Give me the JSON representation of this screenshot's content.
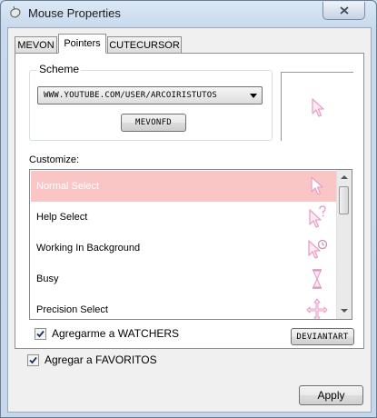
{
  "window": {
    "title": "Mouse Properties"
  },
  "tabs": [
    {
      "label": "MEVON"
    },
    {
      "label": "Pointers"
    },
    {
      "label": "CUTECURSOR"
    }
  ],
  "scheme": {
    "label": "Scheme",
    "selected": "WWW.YOUTUBE.COM/USER/ARCOIRISTUTOS",
    "button_label": "MEVONFD"
  },
  "customize": {
    "label": "Customize:",
    "rows": [
      {
        "label": "Normal Select",
        "icon": "arrow-cursor-icon",
        "selected": true
      },
      {
        "label": "Help Select",
        "icon": "help-cursor-icon",
        "selected": false
      },
      {
        "label": "Working In Background",
        "icon": "busy-background-cursor-icon",
        "selected": false
      },
      {
        "label": "Busy",
        "icon": "hourglass-cursor-icon",
        "selected": false
      },
      {
        "label": "Precision Select",
        "icon": "precision-cursor-icon",
        "selected": false
      }
    ]
  },
  "options": {
    "watchers": {
      "label": "Agregarme a WATCHERS",
      "checked": true
    },
    "favoritos": {
      "label": "Agregar a FAVORITOS",
      "checked": true
    },
    "deviantart_button": "DEVIANTART"
  },
  "footer": {
    "apply_label": "Apply"
  },
  "colors": {
    "selection": "#f9c6c5",
    "cursor_outline": "#e9a1c6",
    "cursor_fill": "#fdeaf2"
  }
}
